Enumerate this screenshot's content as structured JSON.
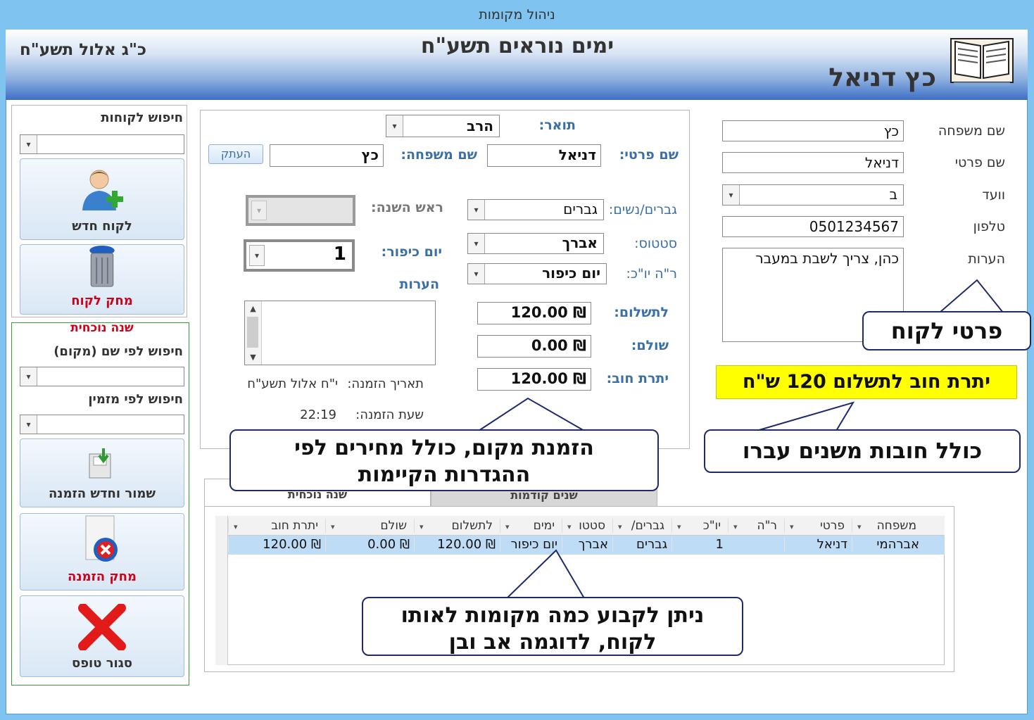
{
  "window": {
    "title": "ניהול מקומות"
  },
  "header": {
    "title": "ימים נוראים תשע\"ח",
    "date": "כ\"ג אלול תשע\"ח",
    "customer_name": "כץ דניאל"
  },
  "customer_details": {
    "last_name_label": "שם משפחה",
    "last_name": "כץ",
    "first_name_label": "שם פרטי",
    "first_name": "דניאל",
    "committee_label": "וועד",
    "committee": "ב",
    "phone_label": "טלפון",
    "phone": "0501234567",
    "notes_label": "הערות",
    "notes": "כהן, צריך לשבת במעבר",
    "debt_banner": "יתרת חוב לתשלום 120 ש\"ח"
  },
  "reservation": {
    "title_label": "תואר:",
    "title_value": "הרב",
    "first_name_label": "שם פרטי:",
    "first_name": "דניאל",
    "last_name_label": "שם משפחה:",
    "last_name": "כץ",
    "copy_button": "העתק",
    "gender_label": "גברים/נשים:",
    "gender": "גברים",
    "status_label": "סטטוס:",
    "status": "אברך",
    "holiday_label": "ר\"ה יו\"כ:",
    "holiday": "יום כיפור",
    "rosh_hashana_label": "ראש השנה:",
    "rosh_hashana_value": "",
    "yom_kippur_label": "יום כיפור:",
    "yom_kippur_value": "1",
    "notes_label": "הערות",
    "to_pay_label": "לתשלום:",
    "to_pay": "₪ 120.00",
    "paid_label": "שולם:",
    "paid": "₪ 0.00",
    "balance_label": "יתרת חוב:",
    "balance": "₪ 120.00",
    "order_date_label": "תאריך הזמנה:",
    "order_date": "י\"ח אלול תשע\"ח",
    "order_time_label": "שעת הזמנה:",
    "order_time": "22:19"
  },
  "sidebar": {
    "search_customers_label": "חיפוש לקוחות",
    "new_customer": "לקוח חדש",
    "delete_customer": "מחק לקוח",
    "current_year": "שנה נוכחית",
    "search_by_place_label": "חיפוש לפי שם (מקום)",
    "search_by_orderer_label": "חיפוש לפי מזמין",
    "save_new_order": "שמור וחדש הזמנה",
    "delete_order": "מחק הזמנה",
    "close_form": "סגור טופס"
  },
  "tabs": {
    "current_year": "שנה נוכחית",
    "previous_years": "שנים קודמות"
  },
  "grid": {
    "columns": [
      "משפחה",
      "פרטי",
      "ר\"ה",
      "יו\"כ",
      "גברים/",
      "סטטו",
      "ימים",
      "לתשלום",
      "שולם",
      "יתרת חוב"
    ],
    "rows": [
      [
        "אברהמי",
        "דניאל",
        "",
        "1",
        "גברים",
        "אברך",
        "יום כיפור",
        "₪ 120.00",
        "₪ 0.00",
        "₪ 120.00"
      ]
    ]
  },
  "callouts": {
    "customer_details": "פרטי לקוח",
    "debts": "כולל חובות משנים עברו",
    "reservation": "הזמנת מקום, כולל מחירים לפי ההגדרות הקיימות",
    "multiple_places": "ניתן לקבוע כמה מקומות לאותו לקוח, לדוגמה אב ובן"
  },
  "colors": {
    "banner_bg": "#ffff00",
    "header_dark": "#3e6fc4",
    "label_blue": "#3a6fa8",
    "danger_red": "#d0021b",
    "callout_border": "#1f2a6b"
  }
}
